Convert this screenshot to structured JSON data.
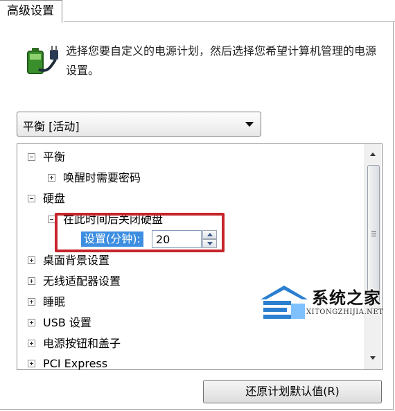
{
  "tab": {
    "label": "高级设置"
  },
  "intro": {
    "text": "选择您要自定义的电源计划，然后选择您希望计算机管理的电源设置。"
  },
  "plan_dropdown": {
    "selected": "平衡 [活动]"
  },
  "tree": {
    "items": [
      {
        "label": "平衡",
        "expanded": true
      },
      {
        "label": "唤醒时需要密码",
        "expanded": false
      },
      {
        "label": "硬盘",
        "expanded": true
      },
      {
        "label": "在此时间后关闭硬盘",
        "expanded": true
      },
      {
        "label": "桌面背景设置",
        "expanded": false
      },
      {
        "label": "无线适配器设置",
        "expanded": false
      },
      {
        "label": "睡眠",
        "expanded": false
      },
      {
        "label": "USB 设置",
        "expanded": false
      },
      {
        "label": "电源按钮和盖子",
        "expanded": false
      },
      {
        "label": "PCI Express",
        "expanded": false
      }
    ],
    "setting": {
      "label": "设置(分钟):",
      "value": "20"
    }
  },
  "buttons": {
    "restore": "还原计划默认值(R)"
  },
  "watermark": {
    "title": "系统之家",
    "url": "XITONGZHIJIA.NET"
  },
  "colors": {
    "highlight_border": "#c6242a",
    "selection": "#3d8ee0"
  }
}
